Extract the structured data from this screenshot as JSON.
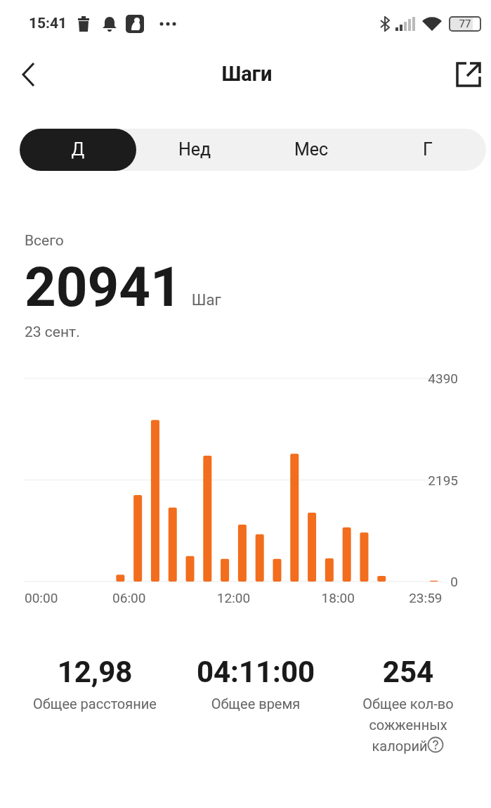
{
  "status_bar": {
    "time": "15:41",
    "battery": "77"
  },
  "header": {
    "title": "Шаги"
  },
  "tabs": [
    {
      "label": "Д",
      "selected": true
    },
    {
      "label": "Нед",
      "selected": false
    },
    {
      "label": "Мес",
      "selected": false
    },
    {
      "label": "Г",
      "selected": false
    }
  ],
  "summary": {
    "label": "Всего",
    "value": "20941",
    "unit": "Шаг",
    "date": "23 сент."
  },
  "chart_data": {
    "type": "bar",
    "x": [
      5.5,
      6.5,
      7.5,
      8.5,
      9.5,
      10.5,
      11.5,
      12.5,
      13.5,
      14.5,
      15.5,
      16.5,
      17.5,
      18.5,
      19.5,
      20.5,
      23.5
    ],
    "values": [
      150,
      1870,
      3490,
      1600,
      550,
      2720,
      490,
      1230,
      1020,
      490,
      2760,
      1490,
      500,
      1170,
      1060,
      120,
      20
    ],
    "xlim": [
      0,
      24
    ],
    "ylim": [
      0,
      4390
    ],
    "yticks": [
      0,
      2195,
      4390
    ],
    "xticks": [
      {
        "value": 0,
        "label": "00:00"
      },
      {
        "value": 6,
        "label": "06:00"
      },
      {
        "value": 12,
        "label": "12:00"
      },
      {
        "value": 18,
        "label": "18:00"
      },
      {
        "value": 23.98,
        "label": "23:59"
      }
    ]
  },
  "stats": [
    {
      "value": "12,98",
      "label": "Общее расстояние",
      "help": false
    },
    {
      "value": "04:11:00",
      "label": "Общее время",
      "help": false
    },
    {
      "value": "254",
      "label": "Общее кол-во сожженных калорий",
      "help": true
    }
  ]
}
